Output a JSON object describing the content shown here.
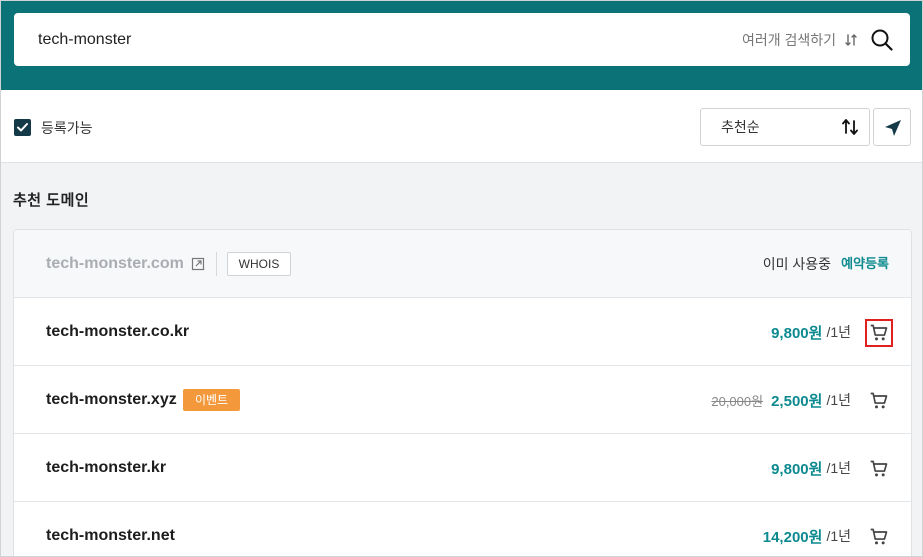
{
  "search": {
    "value": "tech-monster",
    "multi_search_label": "여러개 검색하기"
  },
  "filter": {
    "available_label": "등록가능",
    "available_checked": true,
    "sort_label": "추천순"
  },
  "section": {
    "title": "추천 도메인"
  },
  "taken_domain": {
    "name": "tech-monster.com",
    "whois_label": "WHOIS",
    "status": "이미 사용중",
    "reserve_label": "예약등록"
  },
  "domains": [
    {
      "name": "tech-monster.co.kr",
      "price": "9,800원",
      "period": "/1년"
    },
    {
      "name": "tech-monster.xyz",
      "badge": "이벤트",
      "old_price": "20,000원",
      "price": "2,500원",
      "period": "/1년"
    },
    {
      "name": "tech-monster.kr",
      "price": "9,800원",
      "period": "/1년"
    },
    {
      "name": "tech-monster.net",
      "price": "14,200원",
      "period": "/1년"
    }
  ],
  "colors": {
    "header_bg": "#0b7378",
    "accent": "#0d8a8f",
    "event_badge": "#f3983b",
    "checkbox": "#143947",
    "highlight": "#e0201f"
  },
  "icons": {
    "search": "search-icon",
    "sort": "sort-arrows-icon",
    "share": "send-icon",
    "external": "external-link-icon",
    "cart": "cart-icon"
  }
}
